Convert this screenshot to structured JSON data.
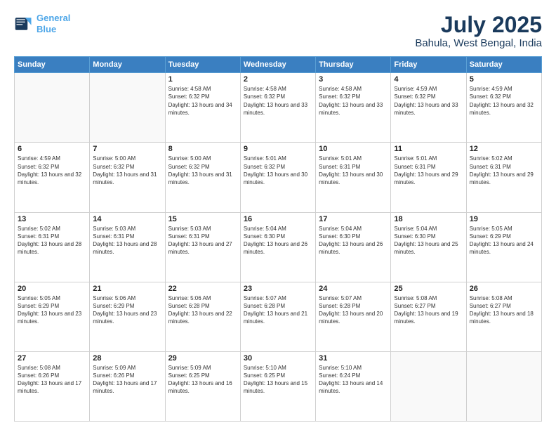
{
  "header": {
    "logo_line1": "General",
    "logo_line2": "Blue",
    "title": "July 2025",
    "subtitle": "Bahula, West Bengal, India"
  },
  "days_of_week": [
    "Sunday",
    "Monday",
    "Tuesday",
    "Wednesday",
    "Thursday",
    "Friday",
    "Saturday"
  ],
  "weeks": [
    [
      {
        "day": "",
        "info": ""
      },
      {
        "day": "",
        "info": ""
      },
      {
        "day": "1",
        "info": "Sunrise: 4:58 AM\nSunset: 6:32 PM\nDaylight: 13 hours and 34 minutes."
      },
      {
        "day": "2",
        "info": "Sunrise: 4:58 AM\nSunset: 6:32 PM\nDaylight: 13 hours and 33 minutes."
      },
      {
        "day": "3",
        "info": "Sunrise: 4:58 AM\nSunset: 6:32 PM\nDaylight: 13 hours and 33 minutes."
      },
      {
        "day": "4",
        "info": "Sunrise: 4:59 AM\nSunset: 6:32 PM\nDaylight: 13 hours and 33 minutes."
      },
      {
        "day": "5",
        "info": "Sunrise: 4:59 AM\nSunset: 6:32 PM\nDaylight: 13 hours and 32 minutes."
      }
    ],
    [
      {
        "day": "6",
        "info": "Sunrise: 4:59 AM\nSunset: 6:32 PM\nDaylight: 13 hours and 32 minutes."
      },
      {
        "day": "7",
        "info": "Sunrise: 5:00 AM\nSunset: 6:32 PM\nDaylight: 13 hours and 31 minutes."
      },
      {
        "day": "8",
        "info": "Sunrise: 5:00 AM\nSunset: 6:32 PM\nDaylight: 13 hours and 31 minutes."
      },
      {
        "day": "9",
        "info": "Sunrise: 5:01 AM\nSunset: 6:32 PM\nDaylight: 13 hours and 30 minutes."
      },
      {
        "day": "10",
        "info": "Sunrise: 5:01 AM\nSunset: 6:31 PM\nDaylight: 13 hours and 30 minutes."
      },
      {
        "day": "11",
        "info": "Sunrise: 5:01 AM\nSunset: 6:31 PM\nDaylight: 13 hours and 29 minutes."
      },
      {
        "day": "12",
        "info": "Sunrise: 5:02 AM\nSunset: 6:31 PM\nDaylight: 13 hours and 29 minutes."
      }
    ],
    [
      {
        "day": "13",
        "info": "Sunrise: 5:02 AM\nSunset: 6:31 PM\nDaylight: 13 hours and 28 minutes."
      },
      {
        "day": "14",
        "info": "Sunrise: 5:03 AM\nSunset: 6:31 PM\nDaylight: 13 hours and 28 minutes."
      },
      {
        "day": "15",
        "info": "Sunrise: 5:03 AM\nSunset: 6:31 PM\nDaylight: 13 hours and 27 minutes."
      },
      {
        "day": "16",
        "info": "Sunrise: 5:04 AM\nSunset: 6:30 PM\nDaylight: 13 hours and 26 minutes."
      },
      {
        "day": "17",
        "info": "Sunrise: 5:04 AM\nSunset: 6:30 PM\nDaylight: 13 hours and 26 minutes."
      },
      {
        "day": "18",
        "info": "Sunrise: 5:04 AM\nSunset: 6:30 PM\nDaylight: 13 hours and 25 minutes."
      },
      {
        "day": "19",
        "info": "Sunrise: 5:05 AM\nSunset: 6:29 PM\nDaylight: 13 hours and 24 minutes."
      }
    ],
    [
      {
        "day": "20",
        "info": "Sunrise: 5:05 AM\nSunset: 6:29 PM\nDaylight: 13 hours and 23 minutes."
      },
      {
        "day": "21",
        "info": "Sunrise: 5:06 AM\nSunset: 6:29 PM\nDaylight: 13 hours and 23 minutes."
      },
      {
        "day": "22",
        "info": "Sunrise: 5:06 AM\nSunset: 6:28 PM\nDaylight: 13 hours and 22 minutes."
      },
      {
        "day": "23",
        "info": "Sunrise: 5:07 AM\nSunset: 6:28 PM\nDaylight: 13 hours and 21 minutes."
      },
      {
        "day": "24",
        "info": "Sunrise: 5:07 AM\nSunset: 6:28 PM\nDaylight: 13 hours and 20 minutes."
      },
      {
        "day": "25",
        "info": "Sunrise: 5:08 AM\nSunset: 6:27 PM\nDaylight: 13 hours and 19 minutes."
      },
      {
        "day": "26",
        "info": "Sunrise: 5:08 AM\nSunset: 6:27 PM\nDaylight: 13 hours and 18 minutes."
      }
    ],
    [
      {
        "day": "27",
        "info": "Sunrise: 5:08 AM\nSunset: 6:26 PM\nDaylight: 13 hours and 17 minutes."
      },
      {
        "day": "28",
        "info": "Sunrise: 5:09 AM\nSunset: 6:26 PM\nDaylight: 13 hours and 17 minutes."
      },
      {
        "day": "29",
        "info": "Sunrise: 5:09 AM\nSunset: 6:25 PM\nDaylight: 13 hours and 16 minutes."
      },
      {
        "day": "30",
        "info": "Sunrise: 5:10 AM\nSunset: 6:25 PM\nDaylight: 13 hours and 15 minutes."
      },
      {
        "day": "31",
        "info": "Sunrise: 5:10 AM\nSunset: 6:24 PM\nDaylight: 13 hours and 14 minutes."
      },
      {
        "day": "",
        "info": ""
      },
      {
        "day": "",
        "info": ""
      }
    ]
  ]
}
